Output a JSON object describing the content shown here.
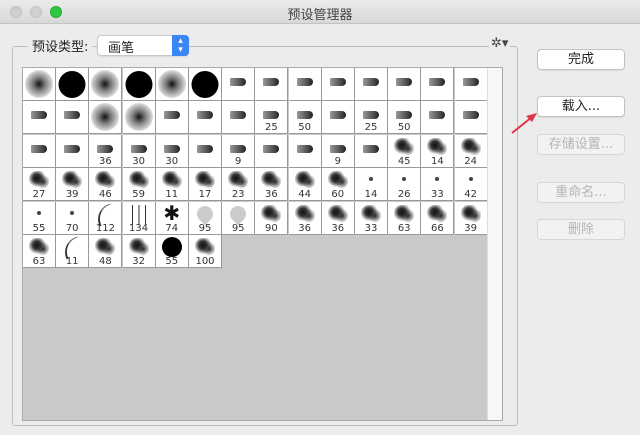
{
  "window": {
    "title": "预设管理器"
  },
  "preset_type": {
    "label": "预设类型:",
    "value": "画笔"
  },
  "buttons": {
    "done": "完成",
    "load": "载入...",
    "save": "存储设置...",
    "rename": "重命名...",
    "delete": "删除"
  },
  "colors": {
    "accent": "#3a86f5",
    "annotation_arrow": "#e0344a",
    "close_light": "#d0d0d0",
    "zoom_light": "#2fc840"
  },
  "brushes": [
    [
      {
        "i": "soft"
      },
      {
        "i": "hard"
      },
      {
        "i": "soft"
      },
      {
        "i": "hard"
      },
      {
        "i": "soft"
      },
      {
        "i": "hard"
      },
      {
        "i": "tip"
      },
      {
        "i": "tip"
      },
      {
        "i": "tip"
      },
      {
        "i": "tip"
      },
      {
        "i": "tip"
      },
      {
        "i": "tip"
      },
      {
        "i": "tip"
      },
      {
        "i": "tip"
      }
    ],
    [
      {
        "i": "tip"
      },
      {
        "i": "tip"
      },
      {
        "i": "soft"
      },
      {
        "i": "soft"
      },
      {
        "i": "tip"
      },
      {
        "i": "tip"
      },
      {
        "i": "tip"
      },
      {
        "i": "tip",
        "n": "25"
      },
      {
        "i": "tip",
        "n": "50"
      },
      {
        "i": "tip"
      },
      {
        "i": "tip",
        "n": "25"
      },
      {
        "i": "tip",
        "n": "50"
      },
      {
        "i": "tip"
      },
      {
        "i": "tip"
      }
    ],
    [
      {
        "i": "tip"
      },
      {
        "i": "tip"
      },
      {
        "i": "tip",
        "n": "36"
      },
      {
        "i": "tip",
        "n": "30"
      },
      {
        "i": "tip",
        "n": "30"
      },
      {
        "i": "tip"
      },
      {
        "i": "tip",
        "n": "9"
      },
      {
        "i": "tip"
      },
      {
        "i": "tip"
      },
      {
        "i": "tip",
        "n": "9"
      },
      {
        "i": "tip"
      },
      {
        "i": "splat",
        "n": "45"
      },
      {
        "i": "splat",
        "n": "14"
      },
      {
        "i": "splat",
        "n": "24"
      }
    ],
    [
      {
        "i": "splat",
        "n": "27"
      },
      {
        "i": "splat",
        "n": "39"
      },
      {
        "i": "splat",
        "n": "46"
      },
      {
        "i": "splat",
        "n": "59"
      },
      {
        "i": "splat",
        "n": "11"
      },
      {
        "i": "splat",
        "n": "17"
      },
      {
        "i": "splat",
        "n": "23"
      },
      {
        "i": "splat",
        "n": "36"
      },
      {
        "i": "splat",
        "n": "44"
      },
      {
        "i": "splat",
        "n": "60"
      },
      {
        "i": "dot",
        "n": "14"
      },
      {
        "i": "dot",
        "n": "26"
      },
      {
        "i": "dot",
        "n": "33"
      },
      {
        "i": "dot",
        "n": "42"
      }
    ],
    [
      {
        "i": "dot",
        "n": "55"
      },
      {
        "i": "dot",
        "n": "70"
      },
      {
        "i": "stroke",
        "n": "112"
      },
      {
        "i": "grass",
        "n": "134"
      },
      {
        "i": "leaf",
        "n": "74"
      },
      {
        "i": "faint",
        "n": "95"
      },
      {
        "i": "faint",
        "n": "95"
      },
      {
        "i": "splat",
        "n": "90"
      },
      {
        "i": "splat",
        "n": "36"
      },
      {
        "i": "splat",
        "n": "36"
      },
      {
        "i": "splat",
        "n": "33"
      },
      {
        "i": "splat",
        "n": "63"
      },
      {
        "i": "splat",
        "n": "66"
      },
      {
        "i": "splat",
        "n": "39"
      }
    ],
    [
      {
        "i": "splat",
        "n": "63"
      },
      {
        "i": "stroke",
        "n": "11"
      },
      {
        "i": "splat",
        "n": "48"
      },
      {
        "i": "splat",
        "n": "32"
      },
      {
        "i": "hard-small",
        "n": "55"
      },
      {
        "i": "splat",
        "n": "100"
      }
    ]
  ]
}
